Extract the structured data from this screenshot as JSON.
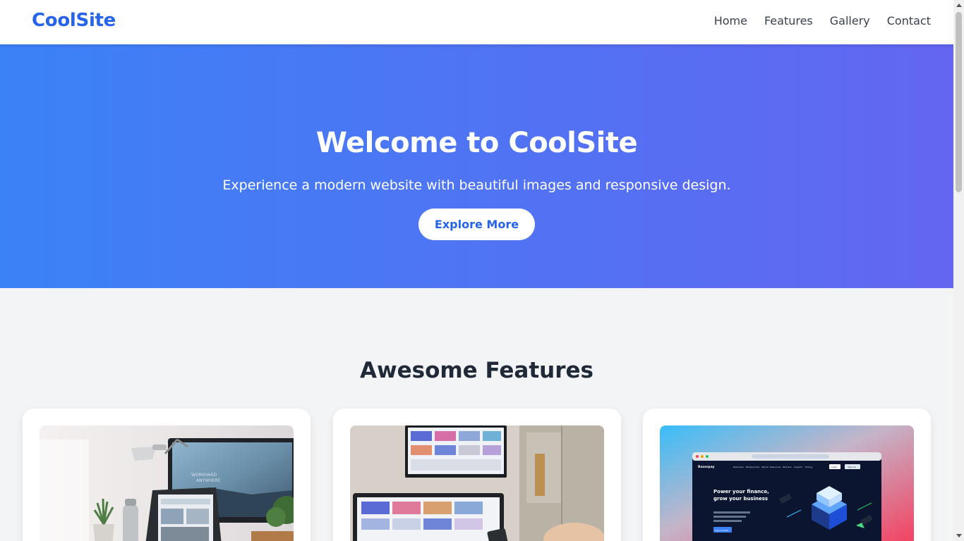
{
  "header": {
    "brand": "CoolSite",
    "nav": [
      {
        "label": "Home"
      },
      {
        "label": "Features"
      },
      {
        "label": "Gallery"
      },
      {
        "label": "Contact"
      }
    ]
  },
  "hero": {
    "title": "Welcome to CoolSite",
    "subtitle": "Experience a modern website with beautiful images and responsive design.",
    "button_label": "Explore More"
  },
  "features": {
    "title": "Awesome Features",
    "cards": [
      {
        "image": "workspace-desk-photo"
      },
      {
        "image": "office-screens-photo"
      },
      {
        "image": "finance-website-screenshot",
        "screenshot_text": {
          "logo": "Razorpay",
          "menu": [
            "Payments",
            "Banking Plus",
            "Payroll",
            "Resources",
            "Partners",
            "Support",
            "Pricing"
          ],
          "login": "Login",
          "signup": "Sign Up",
          "headline_1": "Power your finance,",
          "headline_2": "grow your business",
          "cta": "Sign Up Now"
        }
      }
    ]
  },
  "colors": {
    "brand": "#2563eb",
    "hero_gradient_start": "#3b82f6",
    "hero_gradient_end": "#6366f1"
  }
}
